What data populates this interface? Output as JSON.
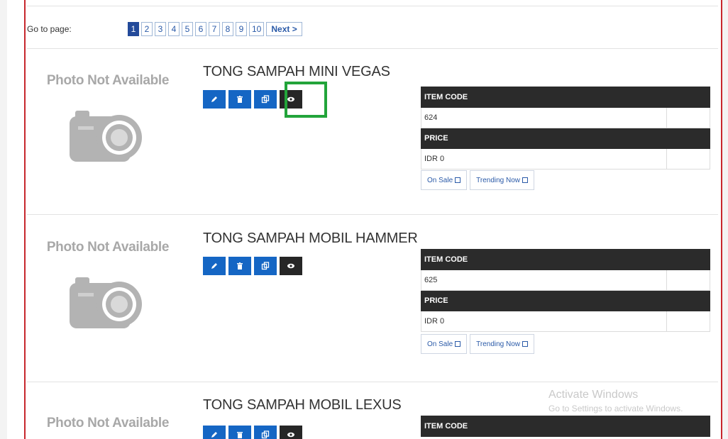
{
  "pagination": {
    "label": "Go to page:",
    "pages": [
      "1",
      "2",
      "3",
      "4",
      "5",
      "6",
      "7",
      "8",
      "9",
      "10"
    ],
    "active": "1",
    "next_label": "Next >"
  },
  "photo_placeholder": "Photo Not Available",
  "products": [
    {
      "title": "TONG SAMPAH MINI VEGAS",
      "item_code_label": "ITEM CODE",
      "item_code": "624",
      "price_label": "PRICE",
      "price": "IDR 0",
      "on_sale_label": "On Sale",
      "trending_label": "Trending Now"
    },
    {
      "title": "TONG SAMPAH MOBIL HAMMER",
      "item_code_label": "ITEM CODE",
      "item_code": "625",
      "price_label": "PRICE",
      "price": "IDR 0",
      "on_sale_label": "On Sale",
      "trending_label": "Trending Now"
    },
    {
      "title": "TONG SAMPAH MOBIL LEXUS",
      "item_code_label": "ITEM CODE"
    }
  ],
  "action_icons": [
    "pencil-icon",
    "trash-icon",
    "copy-icon",
    "eye-icon"
  ],
  "watermark": {
    "line1": "Activate Windows",
    "line2": "Go to Settings to activate Windows."
  },
  "colors": {
    "action_blue": "#1566c4",
    "view_dark": "#262626",
    "highlight": "#22a43a",
    "table_header": "#2b2b2b",
    "link_blue": "#2a5aa8"
  }
}
